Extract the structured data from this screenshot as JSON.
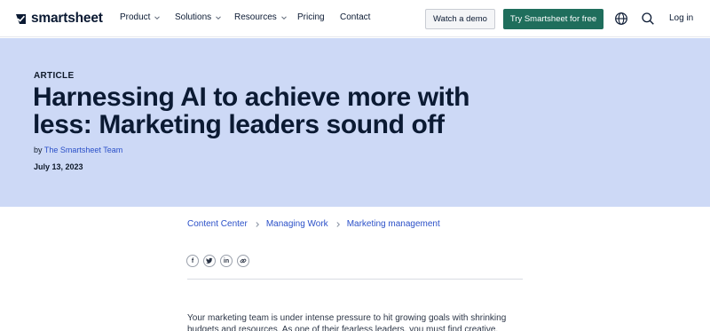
{
  "brand": {
    "name": "smartsheet"
  },
  "nav": {
    "items": [
      {
        "label": "Product",
        "has_dropdown": true
      },
      {
        "label": "Solutions",
        "has_dropdown": true
      },
      {
        "label": "Resources",
        "has_dropdown": true
      },
      {
        "label": "Pricing",
        "has_dropdown": false
      },
      {
        "label": "Contact",
        "has_dropdown": false
      }
    ],
    "watch_demo": "Watch a demo",
    "try_free": "Try Smartsheet for free",
    "login": "Log in",
    "icons": [
      "globe-icon",
      "search-icon"
    ]
  },
  "hero": {
    "eyebrow": "ARTICLE",
    "title": "Harnessing AI to achieve more with less: Marketing leaders sound off",
    "by_prefix": "by",
    "author": "The Smartsheet Team",
    "date": "July 13, 2023"
  },
  "breadcrumb": [
    "Content Center",
    "Managing Work",
    "Marketing management"
  ],
  "share": {
    "icons": [
      "facebook-icon",
      "twitter-icon",
      "linkedin-icon",
      "link-icon"
    ]
  },
  "body": {
    "intro": "Your marketing team is under intense pressure to hit growing goals with shrinking budgets and resources. As one of their fearless leaders, you must find creative, cutting-"
  },
  "colors": {
    "hero_bg": "#cdd9f6",
    "primary_button": "#1f6e5c",
    "link": "#2b50c8",
    "text": "#0b1a33"
  }
}
